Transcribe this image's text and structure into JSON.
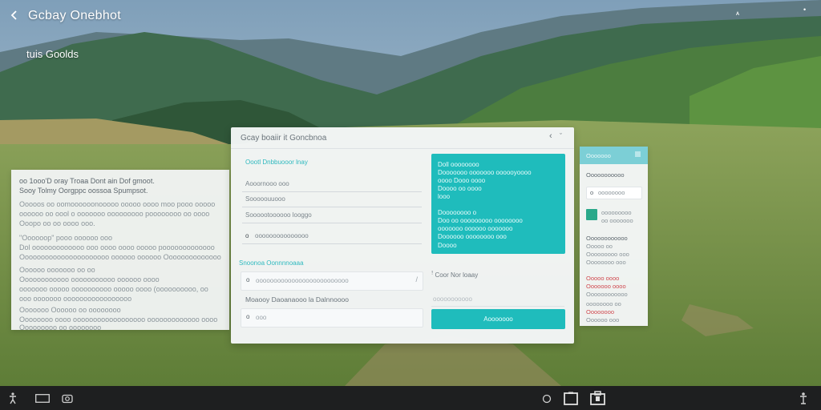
{
  "app": {
    "title": "Gcbay Onebhot",
    "section_label": "tuis Goolds",
    "status_a": "ᴬ",
    "status_b": "•"
  },
  "left_panel": {
    "lines": [
      "oo 1ooo'D oray Troaa Dont ain Dof gmoot.",
      "Sooy Tolmy Oorgppc oossoa Spumpsot.",
      "Ooooos oo oomoooooonooooo ooooo oooo moo pooo ooooo",
      "oooooo oo oool o ooooooo ooooooooo poooooooo oo oooo",
      "Ooopo oo oo oooo ooo.",
      "\"Oooooop\" pooo oooooo ooo",
      "Dol ooooooooooooo ooo oooo oooo ooooo pooooooooooooo",
      "Oooooooooooooooooooooo oooooo oooooo Oooooooooooooooo",
      "Oooooo ooooooo oo oo",
      "Oooooooooooo ooooooooooo oooooo oooo",
      "ooooooo ooooo oooooooooo ooooo oooo (oooooooooo, oo",
      "ooo ooooooo ooooooooooooooooo",
      "Ooooooo Oooooo oo oooooooo",
      "Oooooooo oooo oooooooooooooooooo ooooooooooooo oooo",
      "Ooooooooo oo oooooooo"
    ]
  },
  "dialog": {
    "title": "Gcay boaiir it Goncbnoa",
    "nav_left": "‹",
    "nav_right": "ˇ",
    "label_1": "Oootl Dnbbuooor lnay",
    "field_1": "Aooornooo ooo",
    "field_2": "Sooooouuooo",
    "field_3": "Soooootoooooo looggo",
    "field_4_bullet": "o",
    "field_4": "ooooooooooooooo",
    "section_2": "Snoonoa Oonnnnoaaa",
    "row_1_bullet": "o",
    "row_1": "oooooooooooooooooooooooooo",
    "row_1_right": "/",
    "row_2": "Moaooy Daoanaooo la Dalnnoooo",
    "row_3_bullet": "o",
    "row_3": "ooo",
    "teal_lines": [
      "Doll oooooooo",
      "Dooooooo ooooooo oooooyoooo",
      "oooo Dooo oooo",
      "Doooo oo oooo",
      "looo",
      "Doooooooo o",
      "Doo oo ooooooooo oooooooo",
      "ooooooo oooooo ooooooo",
      "Doooooo oooooooo ooo",
      "Doooo"
    ],
    "aside_label": "ꜝ Coor Nor loaay",
    "aside_placeholder": "ooooooooooo",
    "primary_button": "Aooooooo"
  },
  "side_panel": {
    "header_text": "Ooooooo",
    "line_1": "Ooooooooooo",
    "chip_bullet": "o",
    "chip_text": "oooooooo",
    "chart_line_1": "ooooooooo",
    "chart_line_2": "oo ooooooo",
    "lines": [
      "Oooooooooooo",
      "Ooooo oo",
      "Ooooooooo ooo",
      "Oooooooo ooo"
    ],
    "red_lines": [
      "Ooooo oooo",
      "Ooooooo oooo",
      "Oooooooooooo"
    ],
    "footer_lines": [
      "oooooooo oo",
      "Oooooooo",
      "Oooooo ooo"
    ]
  },
  "taskbar": {
    "icons": [
      "accessibility-icon",
      "window-icon",
      "camera-icon",
      "circle-icon",
      "square-icon",
      "lock-icon",
      "user-icon"
    ]
  },
  "colors": {
    "accent": "#1fbcbc",
    "taskbar": "#1e1f20"
  }
}
